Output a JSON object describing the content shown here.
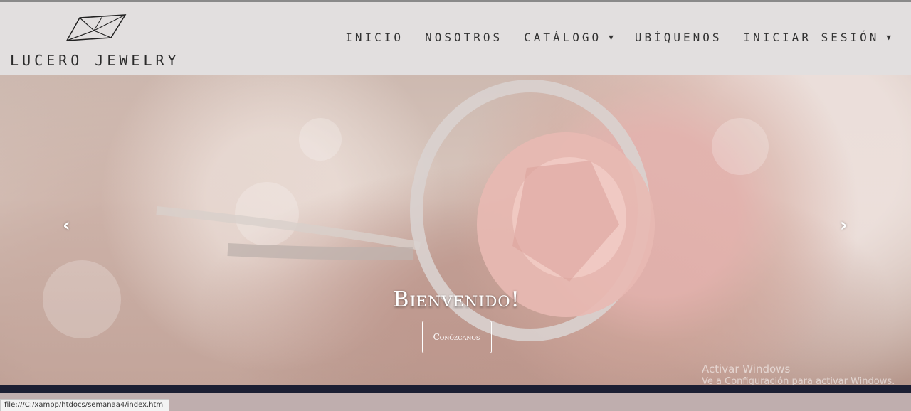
{
  "navbar": {
    "brand_name": "LUCERO JEWELRY",
    "links": [
      {
        "label": "INICIO"
      },
      {
        "label": "NOSOTROS"
      },
      {
        "label": "CATÁLOGO"
      },
      {
        "label": "UBÍQUENOS"
      },
      {
        "label": "INICIAR SESIÓN"
      }
    ]
  },
  "hero": {
    "title": "Bienvenido!",
    "button_label": "Conózcanos",
    "prev_icon": "chevron-left-icon",
    "next_icon": "chevron-right-icon"
  },
  "windows_watermark": {
    "line1": "Activar Windows",
    "line2": "Ve a Configuración para activar Windows."
  },
  "status_bar": {
    "url": "file:///C:/xampp/htdocs/semanaa4/index.html"
  }
}
